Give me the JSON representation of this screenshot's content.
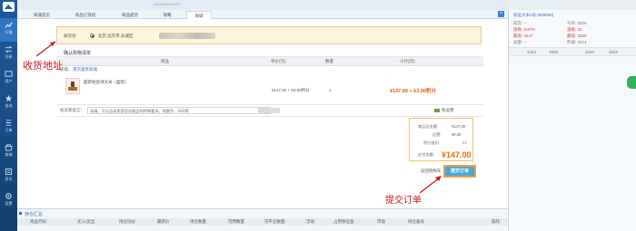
{
  "nav": {
    "items": [
      {
        "label": "行情",
        "icon": "chart-icon"
      },
      {
        "label": "交易",
        "icon": "trade-icon"
      },
      {
        "label": "资产",
        "icon": "wallet-icon"
      },
      {
        "label": "自选",
        "icon": "star-icon"
      },
      {
        "label": "订单",
        "icon": "list-icon"
      },
      {
        "label": "商城",
        "icon": "shop-icon"
      },
      {
        "label": "资讯",
        "icon": "news-icon"
      },
      {
        "label": "设置",
        "icon": "gear-icon"
      }
    ]
  },
  "topbar": {
    "text": "1148000000003"
  },
  "tabs": [
    {
      "label": "商城首页"
    },
    {
      "label": "商品订货权"
    },
    {
      "label": "商品提货"
    },
    {
      "label": "攻略"
    },
    {
      "label": "商城"
    }
  ],
  "address": {
    "label": "收货地",
    "value": "北京,北京市,东城区"
  },
  "confirm": {
    "title": "确认购物清单"
  },
  "table": {
    "headers": [
      "商品",
      "单价(元)",
      "数量",
      "小计(元)"
    ]
  },
  "shop": {
    "label": "店铺：",
    "name": "南京富贵商城"
  },
  "item": {
    "name": "超新柱台湾大米（盒装）",
    "price": "¥147.00 + 63.00积分",
    "qty": "1",
    "subtotal": "¥147.00 + 63.00积分"
  },
  "remark": {
    "label": "给卖家留言：",
    "placeholder": "选填，可以告诉卖家您对商品的特殊要求，如颜色、尺码等",
    "favorite": "免运费"
  },
  "summary": {
    "goods_label": "商品总金额:",
    "goods_value": "¥147.00",
    "freight_label": "运费:",
    "freight_value": "¥0.00",
    "points_label": "积分抵扣:",
    "points_value": "63",
    "pay_label": "应付金额:",
    "pay_value": "¥147.00"
  },
  "actions": {
    "back": "返回购物车",
    "submit": "提交订单"
  },
  "annotations": {
    "address": "收货地址",
    "submit": "提交订单"
  },
  "holdings": {
    "title": "持仓汇总",
    "headers": [
      "商品代码",
      "买入/卖出",
      "持仓均价",
      "最新价",
      "持仓数量",
      "可用数量",
      "可平仓数量",
      "浮动",
      "占用保证金",
      "市值",
      "持仓备号",
      "操作"
    ]
  },
  "rpanel": {
    "title": "农远大米1号 (600000)",
    "rows": [
      {
        "l": "成交: --",
        "r": "今开: 3329"
      },
      {
        "l": "涨跌: 0.97%",
        "r": "涨跌: 32"
      },
      {
        "l": "最高: 3347",
        "r": "最低: 3329"
      },
      {
        "l": "总量: --",
        "r": "昨收: 3314"
      }
    ],
    "bid": [
      "3343",
      "3888"
    ],
    "ask": [
      "3346",
      "3949"
    ]
  },
  "colors": {
    "nav": "#1d5aa0",
    "accent_orange": "#e8720d",
    "annotation_red": "#c81818",
    "submit_btn": "#48a8d8"
  }
}
